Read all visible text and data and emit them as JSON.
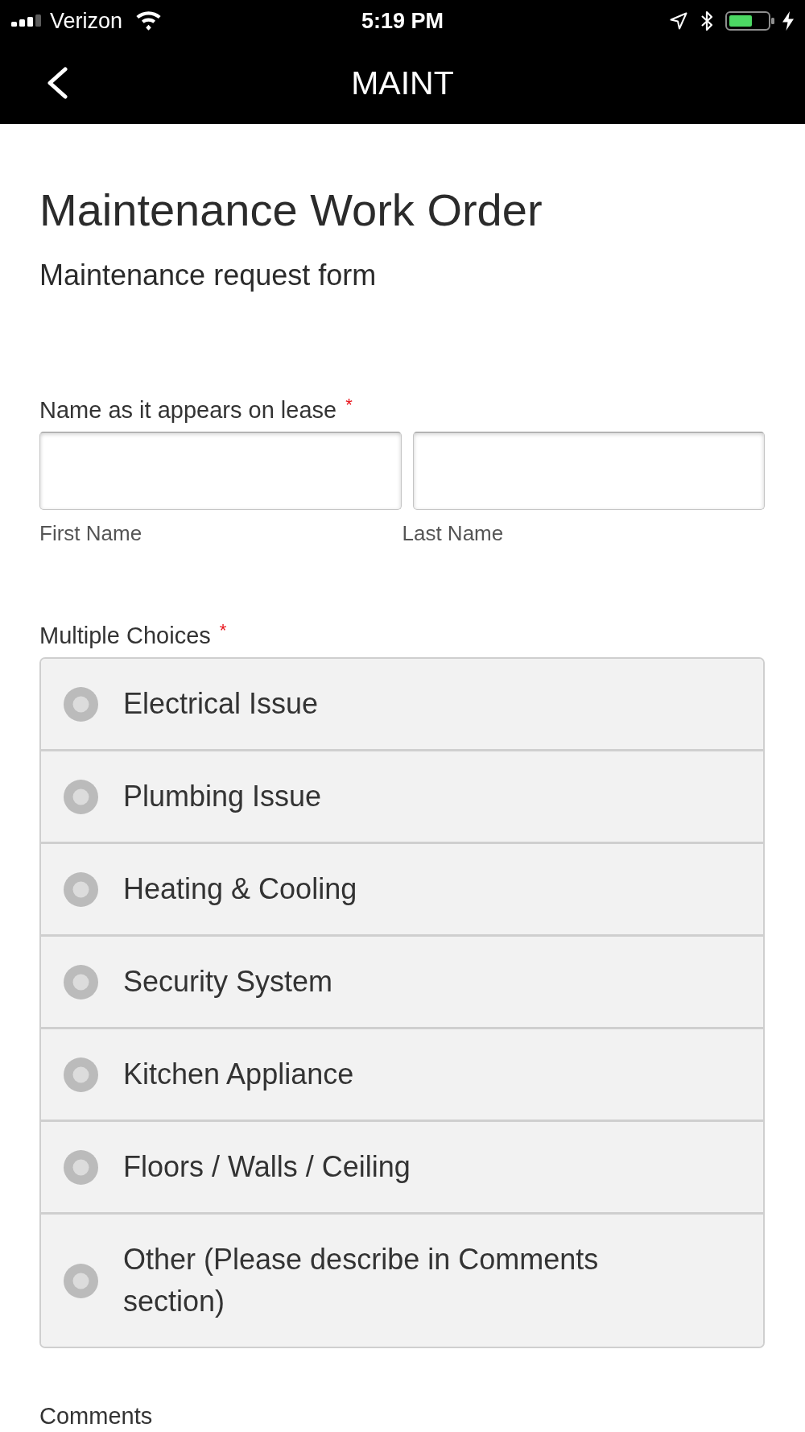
{
  "status_bar": {
    "carrier": "Verizon",
    "time": "5:19 PM"
  },
  "nav_bar": {
    "title": "MAINT"
  },
  "header": {
    "title": "Maintenance Work Order",
    "subtitle": "Maintenance request form"
  },
  "fields": [
    {
      "kind": "name",
      "label": "Name as it appears on lease",
      "required_mark": "*",
      "inputs": [
        {
          "sublabel": "First Name"
        },
        {
          "sublabel": "Last Name"
        }
      ]
    },
    {
      "kind": "choice",
      "label": "Multiple Choices",
      "required_mark": "*",
      "options": [
        {
          "label": "Electrical Issue",
          "selected": false
        },
        {
          "label": "Plumbing Issue",
          "selected": false
        },
        {
          "label": "Heating & Cooling",
          "selected": false
        },
        {
          "label": "Security System",
          "selected": false
        },
        {
          "label": "Kitchen Appliance",
          "selected": false
        },
        {
          "label": "Floors / Walls / Ceiling",
          "selected": false
        },
        {
          "label": "Other (Please describe in Comments section)",
          "selected": false
        }
      ]
    },
    {
      "kind": "comment",
      "label": "Comments"
    }
  ]
}
